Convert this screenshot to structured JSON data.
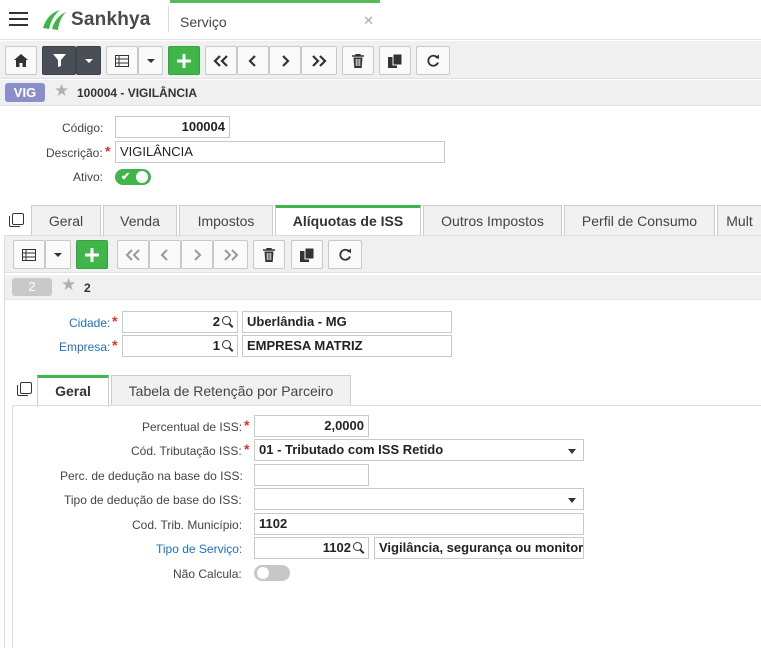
{
  "header": {
    "brand": "Sankhya",
    "tab_title": "Serviço",
    "close_glyph": "✕"
  },
  "record": {
    "badge": "VIG",
    "title": "100004 - VIGILÂNCIA"
  },
  "form": {
    "codigo_label": "Código:",
    "codigo_value": "100004",
    "descricao_label": "Descrição:",
    "descricao_value": "VIGILÂNCIA",
    "ativo_label": "Ativo:",
    "ativo_on": true
  },
  "tabs": [
    {
      "label": "Geral"
    },
    {
      "label": "Venda"
    },
    {
      "label": "Impostos"
    },
    {
      "label": "Alíquotas de ISS",
      "active": true
    },
    {
      "label": "Outros Impostos"
    },
    {
      "label": "Perfil de Consumo"
    },
    {
      "label": "Mult"
    }
  ],
  "sub_record": {
    "badge": "2",
    "title": "2"
  },
  "iss_form": {
    "cidade_label": "Cidade:",
    "cidade_code": "2",
    "cidade_name": "Uberlândia - MG",
    "empresa_label": "Empresa:",
    "empresa_code": "1",
    "empresa_name": "EMPRESA MATRIZ"
  },
  "inner_tabs": [
    {
      "label": "Geral",
      "active": true
    },
    {
      "label": "Tabela de Retenção por Parceiro"
    }
  ],
  "geral_form": {
    "percentual_label": "Percentual de ISS:",
    "percentual_value": "2,0000",
    "cod_trib_label": "Cód. Tributação ISS:",
    "cod_trib_value": "01 - Tributado com ISS Retido",
    "perc_deducao_label": "Perc. de dedução na base do ISS:",
    "perc_deducao_value": "",
    "tipo_deducao_label": "Tipo de dedução de base do ISS:",
    "tipo_deducao_value": "",
    "cod_trib_mun_label": "Cod. Trib. Município:",
    "cod_trib_mun_value": "1102",
    "tipo_servico_label": "Tipo de Serviço:",
    "tipo_servico_code": "1102",
    "tipo_servico_name": "Vigilância, segurança ou monitoramento",
    "nao_calcula_label": "Não Calcula:",
    "nao_calcula_on": false
  },
  "colors": {
    "accent": "#3fb54a",
    "badge": "#8a8fc9",
    "link": "#1f6fbf",
    "required": "#e03030"
  },
  "icons": [
    "menu-icon",
    "home-icon",
    "filter-icon",
    "grid-icon",
    "plus-icon",
    "first-icon",
    "prev-icon",
    "next-icon",
    "last-icon",
    "trash-icon",
    "clone-icon",
    "refresh-icon",
    "star-icon",
    "search-icon",
    "copy-icon"
  ]
}
